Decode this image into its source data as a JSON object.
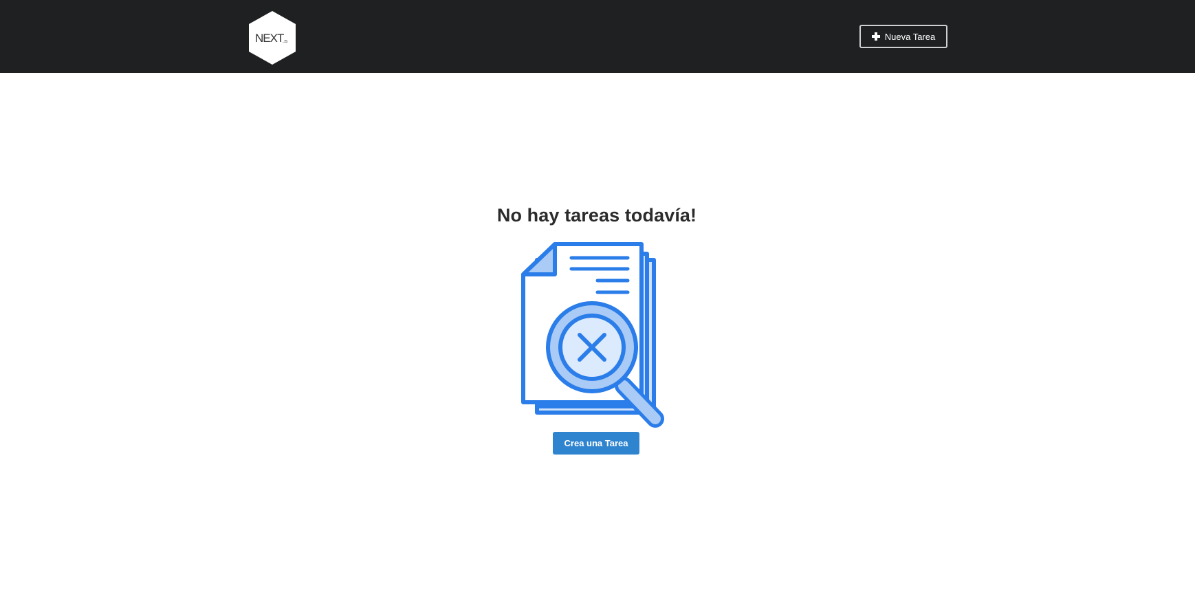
{
  "header": {
    "logo_text": "NEXT",
    "logo_suffix": ".JS",
    "new_task_label": "Nueva Tarea",
    "new_task_icon": "plus-icon"
  },
  "main": {
    "empty_title": "No hay tareas todavía!",
    "illustration_icon": "document-search-not-found-icon",
    "create_button_label": "Crea una Tarea"
  },
  "colors": {
    "navbar_bg": "#1f2022",
    "accent_blue": "#2f84d0",
    "illustration_stroke": "#2b7de9",
    "illustration_fill": "#cfe2fb"
  }
}
